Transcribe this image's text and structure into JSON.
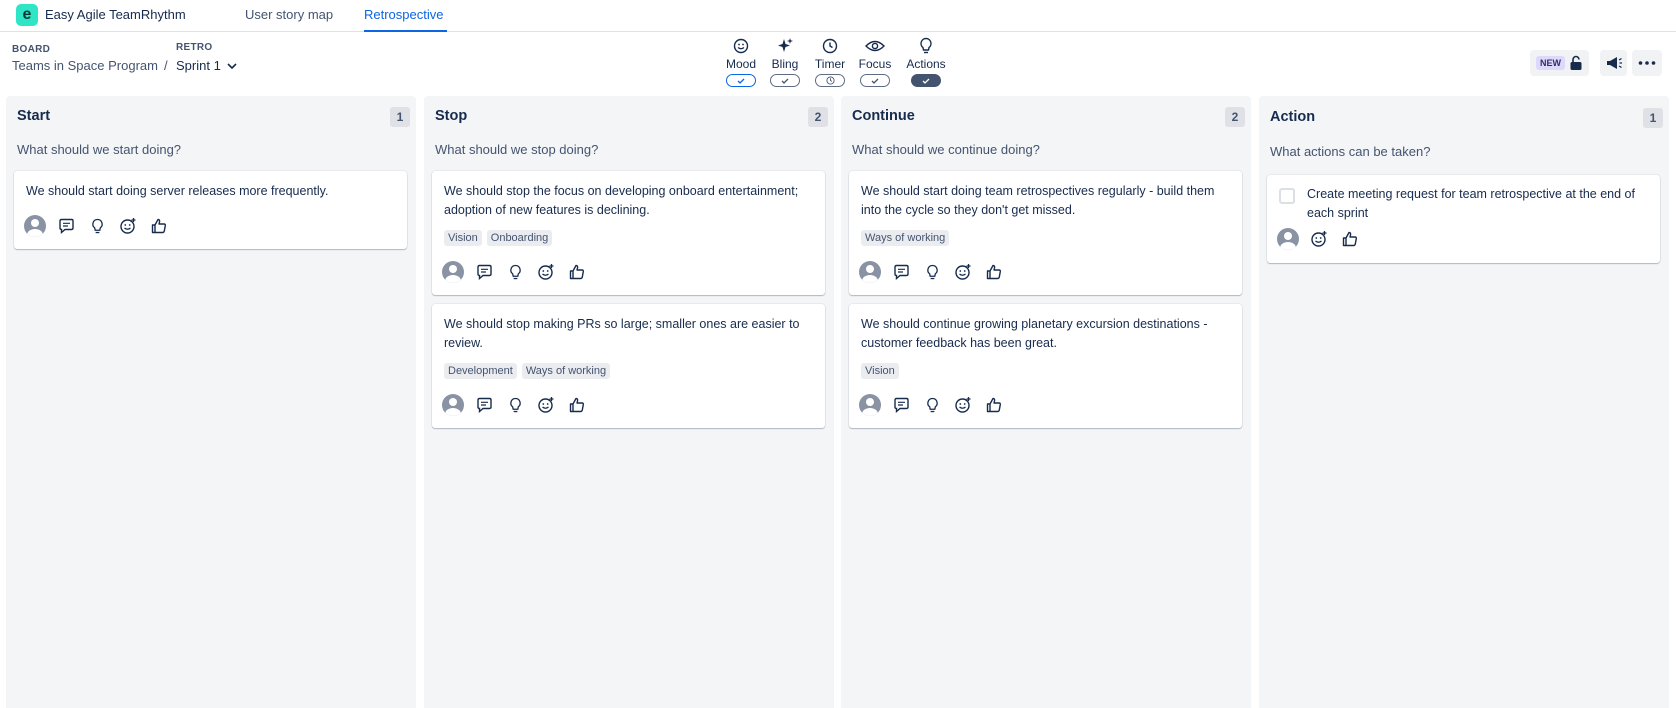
{
  "app": {
    "logo_letter": "e",
    "name": "Easy Agile TeamRhythm"
  },
  "nav": {
    "tabs": [
      {
        "label": "User story map"
      },
      {
        "label": "Retrospective"
      }
    ]
  },
  "breadcrumb": {
    "board_label": "BOARD",
    "board_value": "Teams in Space Program",
    "separator": "/",
    "retro_label": "RETRO",
    "retro_value": "Sprint 1"
  },
  "toolbar": {
    "tools": [
      {
        "label": "Mood",
        "icon": "smiley-icon",
        "state": "on"
      },
      {
        "label": "Bling",
        "icon": "sparkles-icon",
        "state": "on"
      },
      {
        "label": "Timer",
        "icon": "clock-icon",
        "state": "timer"
      },
      {
        "label": "Focus",
        "icon": "eye-icon",
        "state": "on"
      },
      {
        "label": "Actions",
        "icon": "lightbulb-icon",
        "state": "active"
      }
    ],
    "new_badge": "NEW"
  },
  "columns": [
    {
      "title": "Start",
      "count": "1",
      "prompt": "What should we start doing?",
      "cards": [
        {
          "text": "We should start doing server releases more frequently.",
          "tags": []
        }
      ]
    },
    {
      "title": "Stop",
      "count": "2",
      "prompt": "What should we stop doing?",
      "cards": [
        {
          "text": "We should stop the focus on developing onboard entertainment; adoption of new features is declining.",
          "tags": [
            "Vision",
            "Onboarding"
          ]
        },
        {
          "text": "We should stop making PRs so large; smaller ones are easier to review.",
          "tags": [
            "Development",
            "Ways of working"
          ]
        }
      ]
    },
    {
      "title": "Continue",
      "count": "2",
      "prompt": "What should we continue doing?",
      "cards": [
        {
          "text": "We should start doing team retrospectives regularly - build them into the cycle so they don't get missed.",
          "tags": [
            "Ways of working"
          ]
        },
        {
          "text": "We should continue growing planetary excursion destinations - customer feedback has been great.",
          "tags": [
            "Vision"
          ]
        }
      ]
    },
    {
      "title": "Action",
      "count": "1",
      "prompt": "What actions can be taken?",
      "cards": [
        {
          "text": "Create meeting request for team retrospective at the end of each sprint",
          "tags": []
        }
      ]
    }
  ],
  "colors": {
    "accent": "#0c66e4",
    "column_bg": "#f4f5f7",
    "logo": "#2ee6c5"
  }
}
